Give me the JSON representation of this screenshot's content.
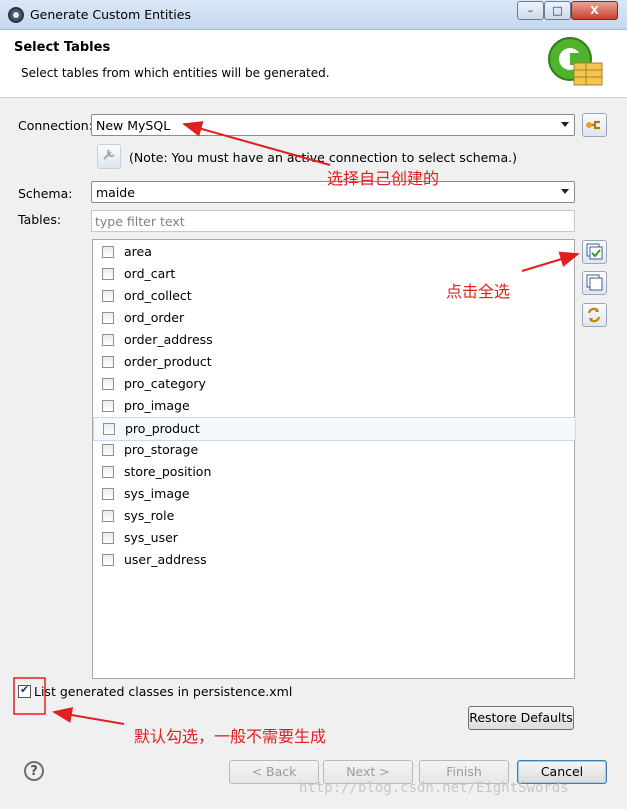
{
  "window": {
    "title": "Generate Custom Entities",
    "minimize_label": "–",
    "maximize_label": "□",
    "close_label": "X"
  },
  "header": {
    "title": "Select Tables",
    "subtitle": "Select tables from which entities will be generated."
  },
  "connection": {
    "label": "Connection:",
    "value": "New MySQL",
    "note": "(Note: You must have an active connection to select schema.)"
  },
  "schema": {
    "label": "Schema:",
    "value": "maide"
  },
  "tables": {
    "label": "Tables:",
    "filter_placeholder": "type filter text",
    "items": [
      {
        "name": "area",
        "checked": false
      },
      {
        "name": "ord_cart",
        "checked": false
      },
      {
        "name": "ord_collect",
        "checked": false
      },
      {
        "name": "ord_order",
        "checked": false
      },
      {
        "name": "order_address",
        "checked": false
      },
      {
        "name": "order_product",
        "checked": false
      },
      {
        "name": "pro_category",
        "checked": false
      },
      {
        "name": "pro_image",
        "checked": false
      },
      {
        "name": "pro_product",
        "checked": false,
        "selected": true
      },
      {
        "name": "pro_storage",
        "checked": false
      },
      {
        "name": "store_position",
        "checked": false
      },
      {
        "name": "sys_image",
        "checked": false
      },
      {
        "name": "sys_role",
        "checked": false
      },
      {
        "name": "sys_user",
        "checked": false
      },
      {
        "name": "user_address",
        "checked": false
      }
    ]
  },
  "options": {
    "list_classes_label": "List generated classes in persistence.xml",
    "list_classes_checked": true,
    "restore_defaults": "Restore Defaults"
  },
  "footer": {
    "help": "?",
    "back": "< Back",
    "next": "Next >",
    "finish": "Finish",
    "cancel": "Cancel"
  },
  "annotations": {
    "connection": "选择自己创建的",
    "select_all": "点击全选",
    "default_checked": "默认勾选，一般不需要生成"
  },
  "watermark": "http://blog.csdn.net/EightSwords",
  "colors": {
    "annotation": "#e02020",
    "accent": "#3c7fb1"
  }
}
